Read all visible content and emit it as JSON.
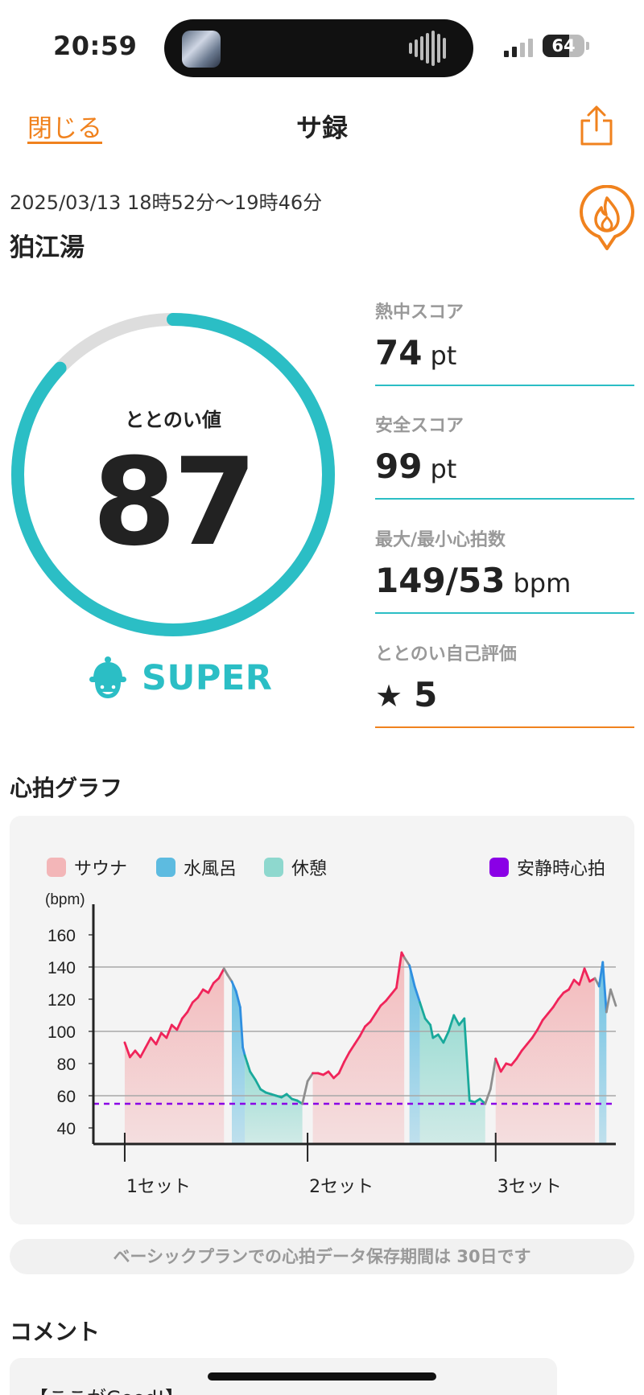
{
  "status_bar": {
    "time": "20:59",
    "battery": "64",
    "battery_level": 0.64
  },
  "header": {
    "close_label": "閉じる",
    "title": "サ録"
  },
  "session": {
    "date_range": "2025/03/13 18時52分〜19時46分",
    "place": "狛江湯"
  },
  "totonoi": {
    "label": "ととのい値",
    "value": "87",
    "gauge_fraction": 0.87,
    "rank": "SUPER",
    "accent_color": "#2BBEC5",
    "track_color": "#DDDDDD"
  },
  "stats": [
    {
      "label": "熱中スコア",
      "value": "74",
      "unit": "pt"
    },
    {
      "label": "安全スコア",
      "value": "99",
      "unit": "pt"
    },
    {
      "label": "最大/最小心拍数",
      "value": "149/53",
      "unit": "bpm"
    },
    {
      "label": "ととのい自己評価",
      "value": "5",
      "unit": ""
    }
  ],
  "heart_graph": {
    "title": "心拍グラフ",
    "legend": [
      {
        "label": "サウナ",
        "color": "#F3B6B8"
      },
      {
        "label": "水風呂",
        "color": "#5DBBE0"
      },
      {
        "label": "休憩",
        "color": "#8ED8CE"
      },
      {
        "label": "安静時心拍",
        "color": "#8A00E6"
      }
    ],
    "notice": "ベーシックプランでの心拍データ保存期間は 30日です"
  },
  "chart_data": {
    "type": "line",
    "ylabel": "(bpm)",
    "ylim": [
      30,
      170
    ],
    "yticks": [
      "160",
      "140",
      "120",
      "100",
      "80",
      "60",
      "40"
    ],
    "xlim": [
      0,
      100
    ],
    "set_labels": [
      "1セット",
      "2セット",
      "3セット"
    ],
    "set_positions": [
      6,
      41,
      77
    ],
    "resting_hr": 55,
    "reference_lines": [
      140,
      100,
      60
    ],
    "phases": [
      {
        "name": "サウナ",
        "start": 6,
        "end": 25
      },
      {
        "name": "水風呂",
        "start": 26.5,
        "end": 29
      },
      {
        "name": "休憩",
        "start": 29,
        "end": 40
      },
      {
        "name": "サウナ",
        "start": 42,
        "end": 59.5
      },
      {
        "name": "水風呂",
        "start": 60.5,
        "end": 62.5
      },
      {
        "name": "休憩",
        "start": 62.5,
        "end": 75
      },
      {
        "name": "サウナ",
        "start": 77,
        "end": 96
      },
      {
        "name": "水風呂",
        "start": 96.5,
        "end": 98.5
      }
    ],
    "series": [
      {
        "name": "心拍",
        "points": [
          [
            6,
            93
          ],
          [
            7,
            84
          ],
          [
            8,
            88
          ],
          [
            9,
            84
          ],
          [
            10,
            90
          ],
          [
            11,
            96
          ],
          [
            12,
            92
          ],
          [
            13,
            99
          ],
          [
            14,
            96
          ],
          [
            15,
            104
          ],
          [
            16,
            101
          ],
          [
            17,
            108
          ],
          [
            18,
            112
          ],
          [
            19,
            118
          ],
          [
            20,
            121
          ],
          [
            21,
            126
          ],
          [
            22,
            124
          ],
          [
            23,
            130
          ],
          [
            24,
            133
          ],
          [
            25,
            139
          ],
          [
            25.7,
            135
          ],
          [
            26.5,
            131
          ],
          [
            27.3,
            125
          ],
          [
            28.1,
            115
          ],
          [
            28.6,
            90
          ],
          [
            29,
            85
          ],
          [
            29.5,
            80
          ],
          [
            30,
            75
          ],
          [
            31,
            70
          ],
          [
            32,
            64
          ],
          [
            33,
            62
          ],
          [
            34,
            61
          ],
          [
            35,
            60
          ],
          [
            36,
            59
          ],
          [
            37,
            61
          ],
          [
            38,
            58
          ],
          [
            39,
            57
          ],
          [
            40,
            55
          ],
          [
            41,
            69
          ],
          [
            42,
            74
          ],
          [
            43,
            74
          ],
          [
            44,
            73
          ],
          [
            45,
            75
          ],
          [
            46,
            71
          ],
          [
            47,
            74
          ],
          [
            48,
            81
          ],
          [
            49,
            87
          ],
          [
            50,
            92
          ],
          [
            51,
            97
          ],
          [
            52,
            103
          ],
          [
            53,
            106
          ],
          [
            54,
            111
          ],
          [
            55,
            116
          ],
          [
            56,
            119
          ],
          [
            57,
            123
          ],
          [
            58,
            127
          ],
          [
            59,
            149
          ],
          [
            59.5,
            146
          ],
          [
            60.5,
            141
          ],
          [
            61.5,
            128
          ],
          [
            62.5,
            118
          ],
          [
            63.5,
            108
          ],
          [
            64.5,
            104
          ],
          [
            65,
            96
          ],
          [
            66,
            98
          ],
          [
            67,
            93
          ],
          [
            68,
            100
          ],
          [
            69,
            110
          ],
          [
            70,
            104
          ],
          [
            71,
            108
          ],
          [
            72,
            57
          ],
          [
            73,
            56
          ],
          [
            74,
            58
          ],
          [
            75,
            55
          ],
          [
            76,
            64
          ],
          [
            77,
            83
          ],
          [
            78,
            75
          ],
          [
            79,
            80
          ],
          [
            80,
            79
          ],
          [
            81,
            83
          ],
          [
            82,
            88
          ],
          [
            83,
            92
          ],
          [
            84,
            96
          ],
          [
            85,
            101
          ],
          [
            86,
            107
          ],
          [
            87,
            111
          ],
          [
            88,
            115
          ],
          [
            89,
            120
          ],
          [
            90,
            124
          ],
          [
            91,
            126
          ],
          [
            92,
            132
          ],
          [
            93,
            129
          ],
          [
            94,
            139
          ],
          [
            95,
            131
          ],
          [
            96,
            133
          ],
          [
            96.8,
            128
          ],
          [
            97.5,
            143
          ],
          [
            98.2,
            112
          ],
          [
            99,
            126
          ],
          [
            100,
            116
          ]
        ]
      }
    ]
  },
  "comment": {
    "title": "コメント",
    "text": "【ここがGood!】"
  }
}
